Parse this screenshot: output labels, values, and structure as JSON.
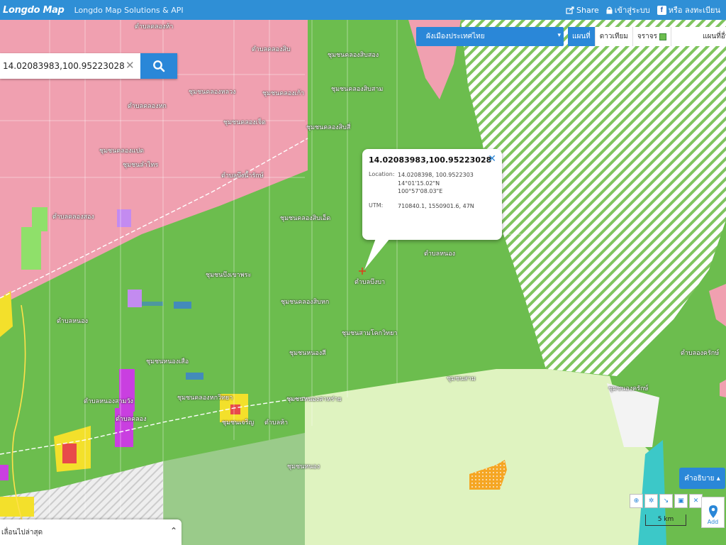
{
  "topbar": {
    "logo": "Longdo Map",
    "brand": "Longdo Map Solutions & API",
    "share_label": "Share",
    "login_label": "เข้าสู่ระบบ",
    "register_label": "หรือ ลงทะเบียน"
  },
  "search": {
    "value": "14.02083983,100.95223028",
    "placeholder": ""
  },
  "layer_panel": {
    "selected_layer": "ผังเมืองประเทศไทย",
    "tabs": [
      "แผนที่",
      "ดาวเทียม",
      "จราจร"
    ],
    "active_tab": "แผนที่",
    "extra_tab": "แผนที่อื่นๆ"
  },
  "popup": {
    "title": "14.02083983,100.95223028",
    "location_label": "Location:",
    "location_decimal": "14.0208398, 100.9522303",
    "location_lat_dms": "14°01'15.02\"N",
    "location_lon_dms": "100°57'08.03\"E",
    "utm_label": "UTM:",
    "utm_value": "710840.1, 1550901.6, 47N"
  },
  "bottom_panel": {
    "label": "เลื่อนไปล่าสุด"
  },
  "legend": {
    "label": "คำอธิบาย"
  },
  "scale": {
    "label": "5 km"
  },
  "add_button": {
    "label": "Add"
  },
  "colors": {
    "topbar": "#2f8fd6",
    "residential_pink": "#f0a0b0",
    "agricultural_green": "#6cbd4e",
    "light_green": "#d9f0b8",
    "hatched_green": "#ffffff",
    "button_blue": "#2a87d8"
  }
}
